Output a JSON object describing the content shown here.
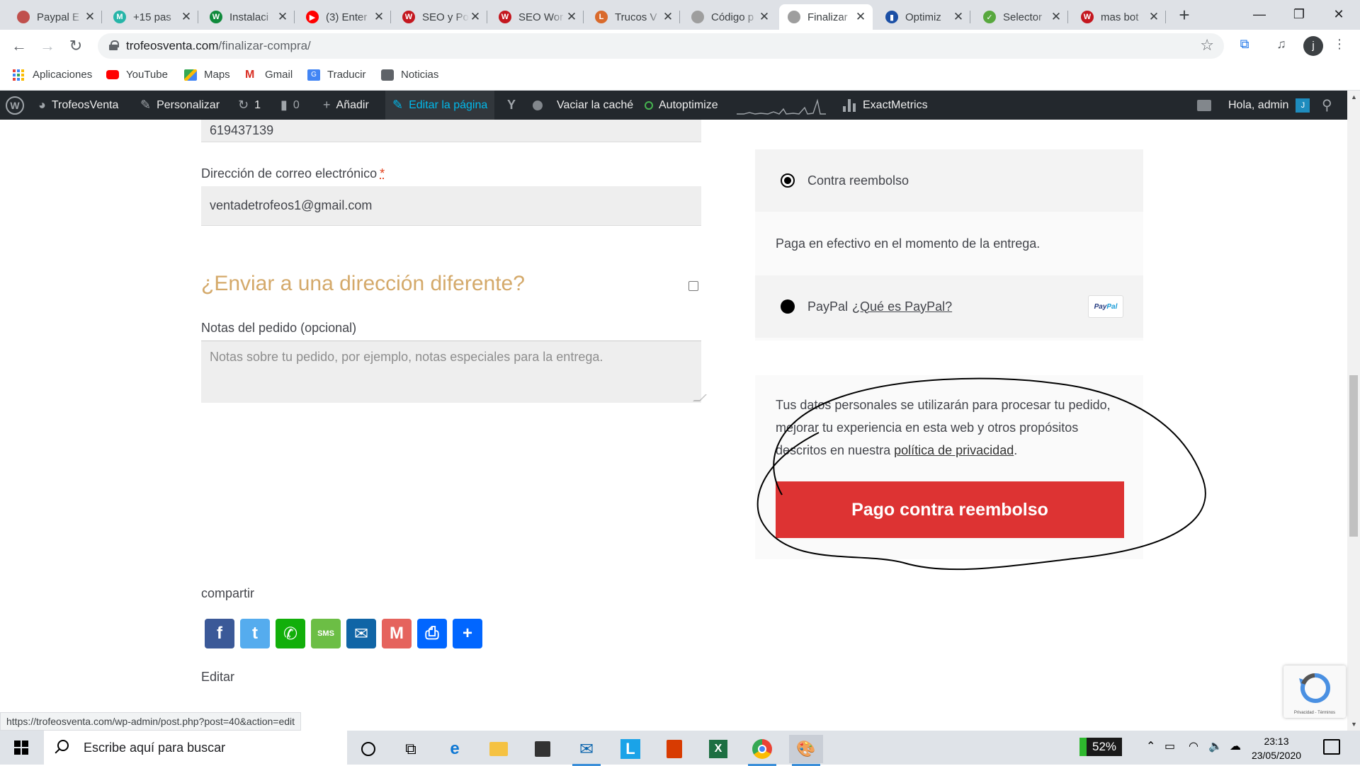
{
  "tabs": [
    {
      "title": "Paypal E",
      "favicon_color": "#c0504d",
      "favicon_text": ""
    },
    {
      "title": "+15 pas",
      "favicon_color": "#26b5a8",
      "favicon_text": "M"
    },
    {
      "title": "Instalaci",
      "favicon_color": "#108a3c",
      "favicon_text": "W"
    },
    {
      "title": "(3) Enter",
      "favicon_color": "#ff0000",
      "favicon_text": "▶"
    },
    {
      "title": "SEO y Po",
      "favicon_color": "#c4171f",
      "favicon_text": "W"
    },
    {
      "title": "SEO Wor",
      "favicon_color": "#c4171f",
      "favicon_text": "W"
    },
    {
      "title": "Trucos V",
      "favicon_color": "#d96a2c",
      "favicon_text": "L"
    },
    {
      "title": "Código p",
      "favicon_color": "#9e9e9e",
      "favicon_text": ""
    },
    {
      "title": "Finalizar",
      "favicon_color": "#9e9e9e",
      "favicon_text": ""
    },
    {
      "title": "Optimiz",
      "favicon_color": "#1b4fa5",
      "favicon_text": "▮"
    },
    {
      "title": "Selector",
      "favicon_color": "#58a83e",
      "favicon_text": "✓"
    },
    {
      "title": "mas bot",
      "favicon_color": "#c4171f",
      "favicon_text": "W"
    }
  ],
  "active_tab_index": 8,
  "address_bar": {
    "domain": "trofeosventa.com",
    "path": "/finalizar-compra/"
  },
  "profile_initial": "j",
  "bookmarks": [
    {
      "label": "Aplicaciones",
      "icon": "apps-grid-icon"
    },
    {
      "label": "YouTube",
      "icon": "youtube-icon"
    },
    {
      "label": "Maps",
      "icon": "maps-icon"
    },
    {
      "label": "Gmail",
      "icon": "gmail-icon"
    },
    {
      "label": "Traducir",
      "icon": "translate-icon"
    },
    {
      "label": "Noticias",
      "icon": "news-icon"
    }
  ],
  "admin_bar": {
    "site_name": "TrofeosVenta",
    "customize": "Personalizar",
    "updates_count": "1",
    "comments_count": "0",
    "add_new": "Añadir",
    "edit_page": "Editar la página",
    "clear_cache": "Vaciar la caché",
    "autoptimize": "Autoptimize",
    "exactmetrics": "ExactMetrics",
    "greeting": "Hola, admin"
  },
  "form": {
    "phone_value": "619437139",
    "email_label": "Dirección de correo electrónico",
    "required_mark": "*",
    "email_value": "ventadetrofeos1@gmail.com",
    "ship_different_heading": "¿Enviar a una dirección diferente?",
    "notes_label": "Notas del pedido (opcional)",
    "notes_placeholder": "Notas sobre tu pedido, por ejemplo, notas especiales para la entrega."
  },
  "payment": {
    "cod_label": "Contra reembolso",
    "cod_description": "Paga en efectivo en el momento de la entrega.",
    "paypal_label": "PayPal",
    "paypal_link": "¿Qué es PayPal?"
  },
  "terms": {
    "text_before": "Tus datos personales se utilizarán para procesar tu pedido, mejorar tu experiencia en esta web y otros propósitos descritos en nuestra",
    "privacy_link": "política de privacidad",
    "text_after": "."
  },
  "place_order_label": "Pago contra reembolso",
  "share": {
    "label": "compartir",
    "buttons": [
      {
        "name": "facebook",
        "color": "#3b5998",
        "glyph": "f"
      },
      {
        "name": "twitter",
        "color": "#55acee",
        "glyph": "t"
      },
      {
        "name": "whatsapp",
        "color": "#12af0a",
        "glyph": "✆"
      },
      {
        "name": "sms",
        "color": "#6cbe45",
        "glyph": "SMS"
      },
      {
        "name": "email",
        "color": "#1065a6",
        "glyph": "✉"
      },
      {
        "name": "gmail",
        "color": "#e5635d",
        "glyph": "M"
      },
      {
        "name": "print",
        "color": "#0166ff",
        "glyph": "⎙"
      },
      {
        "name": "share",
        "color": "#0166ff",
        "glyph": "+"
      }
    ]
  },
  "edit_link": "Editar",
  "status_url": "https://trofeosventa.com/wp-admin/post.php?post=40&action=edit",
  "recaptcha_footer": "Privacidad - Términos",
  "taskbar": {
    "search_placeholder": "Escribe aquí para buscar",
    "battery_percent": "52%",
    "time": "23:13",
    "date": "23/05/2020"
  }
}
